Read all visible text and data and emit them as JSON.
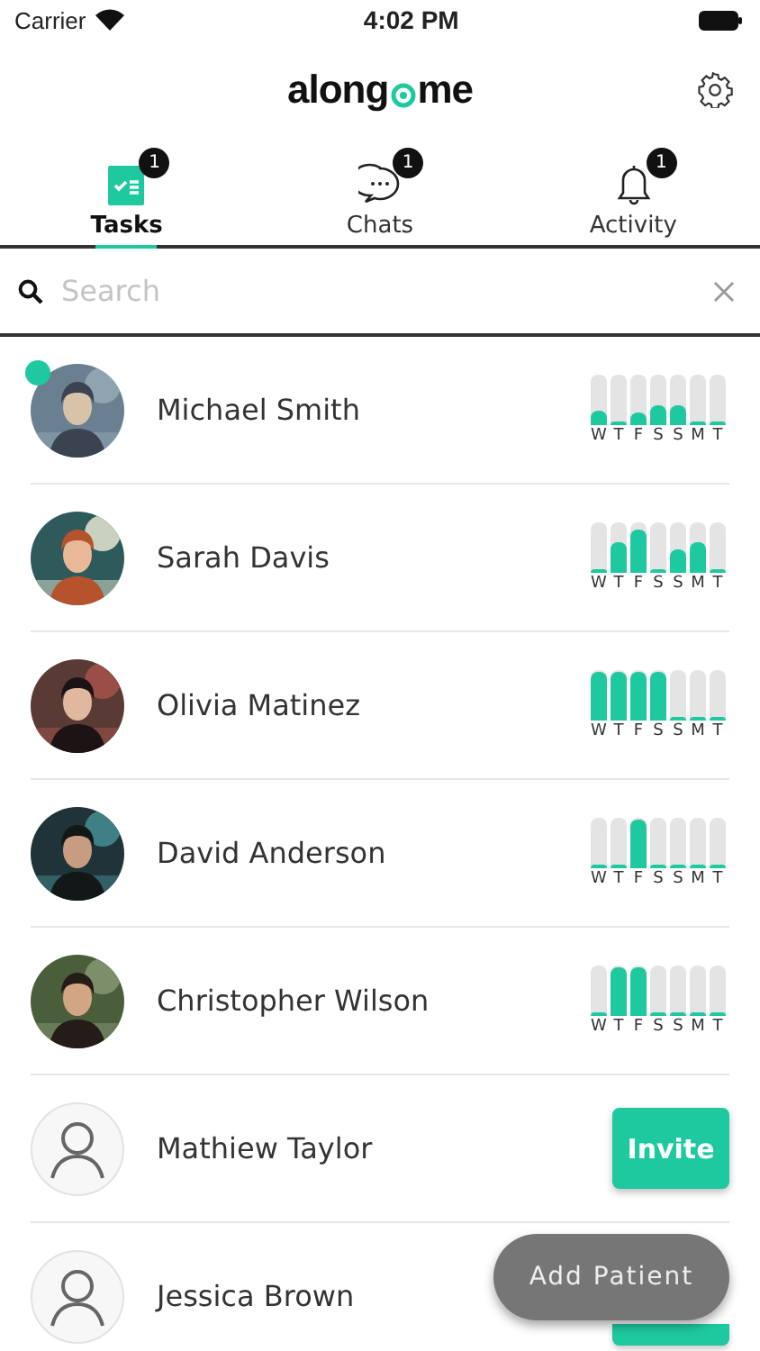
{
  "status_bar": {
    "carrier": "Carrier",
    "time": "4:02 PM"
  },
  "header": {
    "logo_left": "along",
    "logo_right": "me"
  },
  "tabs": [
    {
      "label": "Tasks",
      "badge": "1",
      "selected": true
    },
    {
      "label": "Chats",
      "badge": "1",
      "selected": false
    },
    {
      "label": "Activity",
      "badge": "1",
      "selected": false
    }
  ],
  "search": {
    "placeholder": "Search"
  },
  "patients": [
    {
      "name": "Michael Smith",
      "kind": "active",
      "online": true,
      "days": [
        {
          "day": "W",
          "level": 0.3
        },
        {
          "day": "T",
          "level": 0.08
        },
        {
          "day": "F",
          "level": 0.25
        },
        {
          "day": "S",
          "level": 0.4
        },
        {
          "day": "S",
          "level": 0.4
        },
        {
          "day": "M",
          "level": 0.08
        },
        {
          "day": "T",
          "level": 0.08
        }
      ]
    },
    {
      "name": "Sarah Davis",
      "kind": "active",
      "days": [
        {
          "day": "W",
          "level": 0.08
        },
        {
          "day": "T",
          "level": 0.6
        },
        {
          "day": "F",
          "level": 0.85
        },
        {
          "day": "S",
          "level": 0.08
        },
        {
          "day": "S",
          "level": 0.45
        },
        {
          "day": "M",
          "level": 0.6
        },
        {
          "day": "T",
          "level": 0.08
        }
      ]
    },
    {
      "name": "Olivia Matinez",
      "kind": "active",
      "days": [
        {
          "day": "W",
          "level": 0.95
        },
        {
          "day": "T",
          "level": 0.95
        },
        {
          "day": "F",
          "level": 0.95
        },
        {
          "day": "S",
          "level": 0.95
        },
        {
          "day": "S",
          "level": 0.08
        },
        {
          "day": "M",
          "level": 0.08
        },
        {
          "day": "T",
          "level": 0.08
        }
      ]
    },
    {
      "name": "David Anderson",
      "kind": "active",
      "days": [
        {
          "day": "W",
          "level": 0.08
        },
        {
          "day": "T",
          "level": 0.08
        },
        {
          "day": "F",
          "level": 0.96
        },
        {
          "day": "S",
          "level": 0.08
        },
        {
          "day": "S",
          "level": 0.08
        },
        {
          "day": "M",
          "level": 0.08
        },
        {
          "day": "T",
          "level": 0.08
        }
      ]
    },
    {
      "name": "Christopher Wilson",
      "kind": "active",
      "days": [
        {
          "day": "W",
          "level": 0.08
        },
        {
          "day": "T",
          "level": 0.95
        },
        {
          "day": "F",
          "level": 0.95
        },
        {
          "day": "S",
          "level": 0.08
        },
        {
          "day": "S",
          "level": 0.08
        },
        {
          "day": "M",
          "level": 0.08
        },
        {
          "day": "T",
          "level": 0.08
        }
      ]
    },
    {
      "name": "Mathiew Taylor",
      "kind": "invite",
      "button": "Invite"
    },
    {
      "name": "Jessica Brown",
      "kind": "invite"
    }
  ],
  "fab": {
    "label": "Add Patient"
  }
}
